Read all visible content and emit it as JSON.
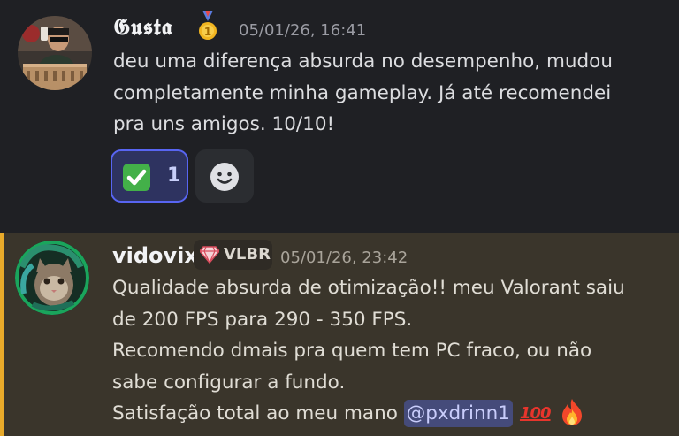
{
  "messages": [
    {
      "author": "𝕲𝖚𝖘𝖙𝖆",
      "badge_icon": "first-place-medal",
      "timestamp": "05/01/26, 16:41",
      "lines": [
        "deu uma diferença absurda no desempenho, mudou",
        "completamente minha gameplay. Já até recomendei",
        "pra uns amigos. 10/10!"
      ],
      "reactions": [
        {
          "emoji": "white-check-mark",
          "count": "1",
          "reacted": true
        }
      ],
      "add_reaction_icon": "smiley-icon"
    },
    {
      "author": "vidovix",
      "role_tag": {
        "icon": "gem-icon",
        "label": "VLBR"
      },
      "timestamp": "05/01/26, 23:42",
      "highlighted": true,
      "lines": [
        "Qualidade absurda de otimização!! meu Valorant saiu",
        "de 200 FPS para 290 - 350 FPS.",
        "Recomendo dmais pra quem tem PC fraco, ou não",
        "sabe configurar a fundo."
      ],
      "last_line": {
        "text": "Satisfação total ao meu mano ",
        "mention": "@pxdrinn1",
        "emoji_hundred": "100",
        "emoji_fire": "fire"
      }
    }
  ],
  "colors": {
    "accent": "#5865f2",
    "highlight": "#e8aa2a",
    "mention_bg": "#454b7a"
  }
}
